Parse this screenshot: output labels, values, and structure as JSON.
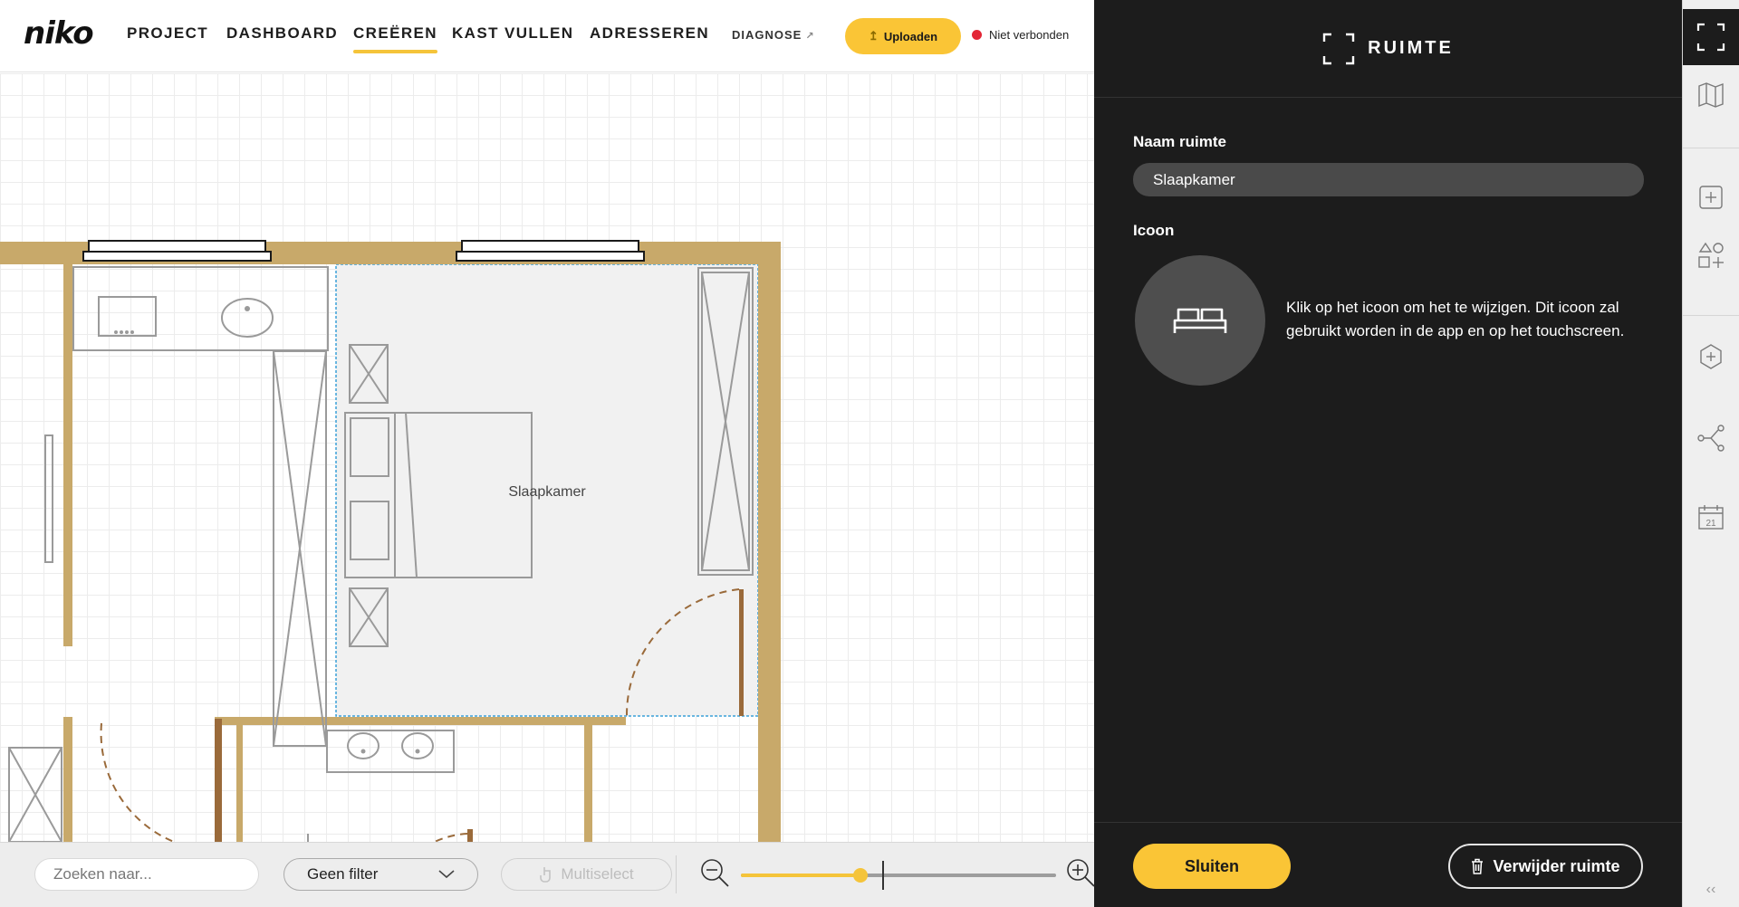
{
  "header": {
    "logo": "niko",
    "nav": [
      {
        "label": "PROJECT",
        "active": false
      },
      {
        "label": "DASHBOARD",
        "active": false
      },
      {
        "label": "CREËREN",
        "active": true
      },
      {
        "label": "KAST VULLEN",
        "active": false
      },
      {
        "label": "ADRESSEREN",
        "active": false
      }
    ],
    "diagnose_label": "DIAGNOSE",
    "upload_label": "Uploaden",
    "connection_status": "Niet verbonden",
    "colors": {
      "accent": "#fac536",
      "status_offline": "#e32636"
    }
  },
  "canvas": {
    "room_label": "Slaapkamer",
    "colors": {
      "wall": "#c8a96a",
      "door_frame": "#9a6a3a",
      "door_swing": "#9a6a3a",
      "selection": "#3aa0d8",
      "furniture": "#9a9a9a"
    }
  },
  "bottom_bar": {
    "search_placeholder": "Zoeken naar...",
    "filter_value": "Geen filter",
    "multiselect_label": "Multiselect",
    "zoom_level": 0.38
  },
  "panel": {
    "title": "RUIMTE",
    "name_label": "Naam ruimte",
    "name_value": "Slaapkamer",
    "icon_label": "Icoon",
    "icon_name": "bed-icon",
    "icon_help": "Klik op het icoon om het te wijzigen. Dit icoon zal gebruikt worden in de app en op het touchscreen.",
    "close_label": "Sluiten",
    "delete_label": "Verwijder ruimte"
  },
  "rail": {
    "calendar_day": "21",
    "items": [
      "room-frame-icon",
      "map-icon",
      "add-square-icon",
      "add-shape-icon",
      "add-hexagon-icon",
      "routing-icon",
      "calendar-icon"
    ]
  }
}
